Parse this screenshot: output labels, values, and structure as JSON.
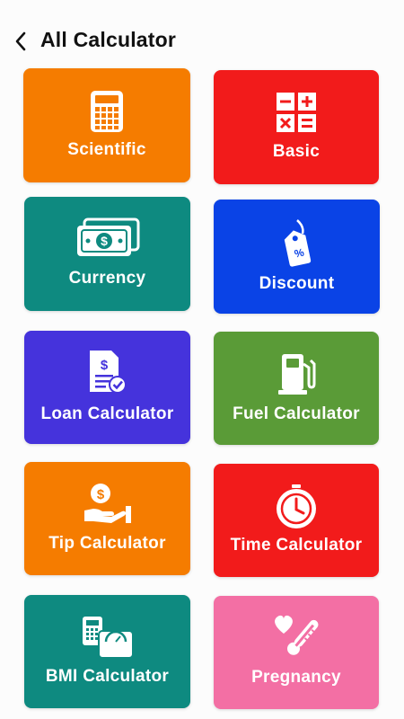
{
  "header": {
    "title": "All Calculator",
    "back_icon": "chevron-left-icon"
  },
  "cards": [
    {
      "label": "Scientific",
      "color": "#f57c00",
      "icon": "calculator-icon"
    },
    {
      "label": "Basic",
      "color": "#f21b1b",
      "icon": "basic-operators-icon"
    },
    {
      "label": "Currency",
      "color": "#0e8a80",
      "icon": "banknotes-icon"
    },
    {
      "label": "Discount",
      "color": "#0a43e6",
      "icon": "price-tag-icon"
    },
    {
      "label": "Loan Calculator",
      "color": "#4533dc",
      "icon": "loan-document-icon"
    },
    {
      "label": "Fuel Calculator",
      "color": "#5a9b37",
      "icon": "fuel-pump-icon"
    },
    {
      "label": "Tip Calculator",
      "color": "#f57c00",
      "icon": "hand-coin-icon"
    },
    {
      "label": "Time Calculator",
      "color": "#f21b1b",
      "icon": "clock-icon"
    },
    {
      "label": "BMI Calculator",
      "color": "#0e8a80",
      "icon": "scale-calculator-icon"
    },
    {
      "label": "Pregnancy",
      "color": "#f36fa4",
      "icon": "thermometer-heart-icon"
    }
  ]
}
